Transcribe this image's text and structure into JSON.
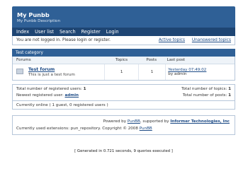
{
  "header": {
    "title": "My Punbb",
    "description": "My Punbb Description"
  },
  "nav": {
    "items": [
      "Index",
      "User list",
      "Search",
      "Register",
      "Login"
    ]
  },
  "status": {
    "message": "You are not logged in. Please login or register.",
    "active_topics": "Active topics",
    "unanswered_topics": "Unanswered topics"
  },
  "category": {
    "name": "Test category",
    "columns": [
      "Forums",
      "Topics",
      "Posts",
      "Last post"
    ],
    "forums": [
      {
        "name": "Test forum",
        "description": "This is just a test forum",
        "topics": "1",
        "posts": "1",
        "last_post": "Yesterday 07:49:02",
        "last_post_by": "by admin"
      }
    ]
  },
  "stats": {
    "registered_users_label": "Total number of registered users:",
    "registered_users": "1",
    "newest_user_label": "Newest registered user:",
    "newest_user": "admin",
    "topics_label": "Total number of topics:",
    "topics": "1",
    "posts_label": "Total number of posts:",
    "posts": "1",
    "online": "Currently online ( 1 guest, 0 registered users )"
  },
  "footer": {
    "powered_prefix": "Powered by",
    "punbb": "PunBB",
    "supported_by": ", supported by",
    "informer": "Informer Technologies, Inc",
    "extensions": "Currently used extensions: pun_repository. Copyright © 2008",
    "copyright_link": "PunBB",
    "generated": "[ Generated in 0.721 seconds, 9 queries executed ]"
  }
}
